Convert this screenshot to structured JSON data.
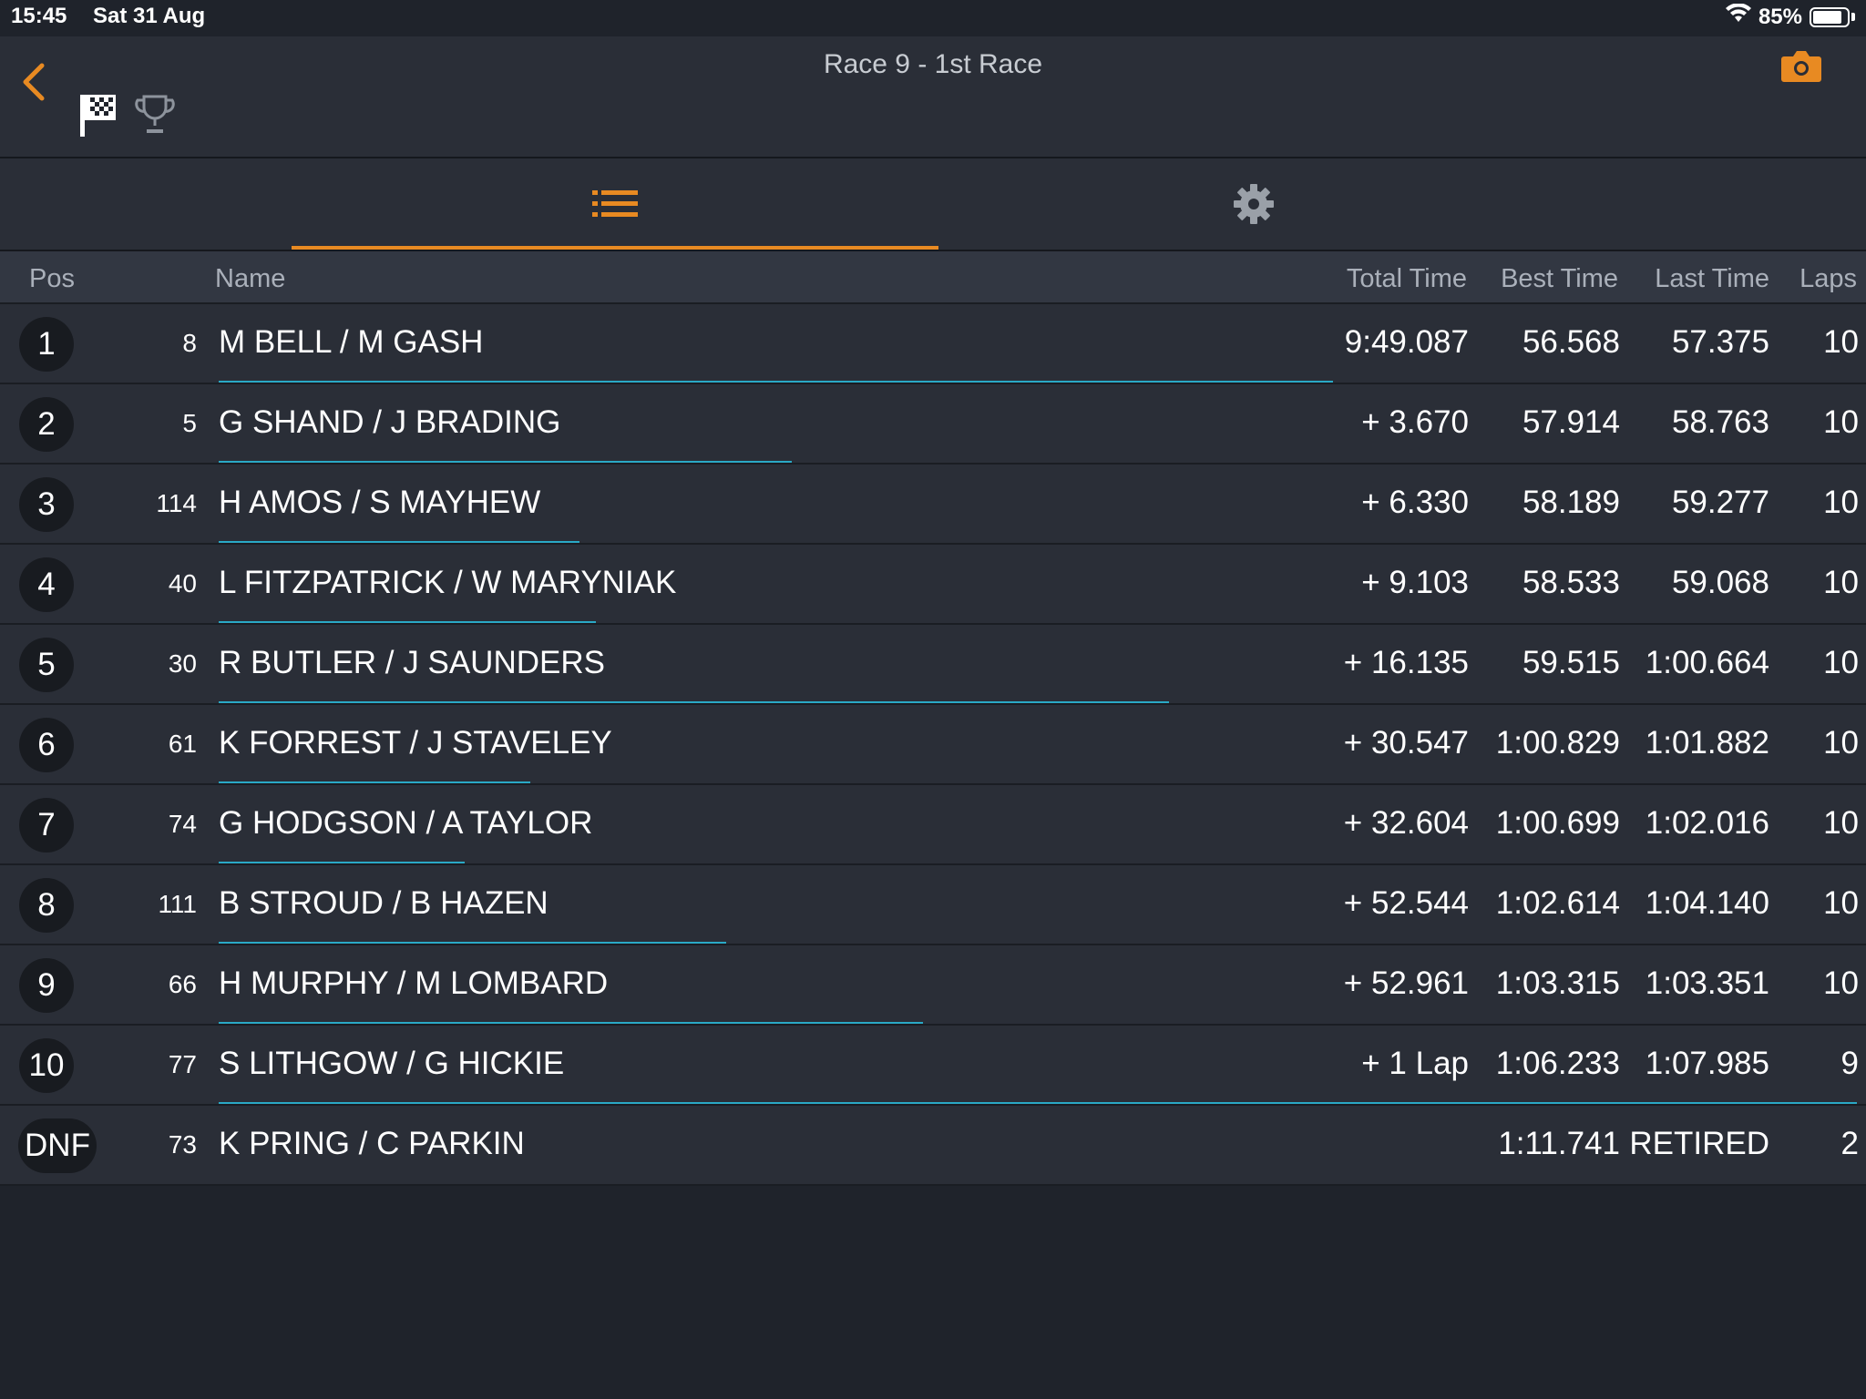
{
  "status": {
    "time": "15:45",
    "date": "Sat 31 Aug",
    "battery": "85%",
    "battery_level": 0.85
  },
  "header": {
    "title": "Race 9 - 1st Race"
  },
  "colors": {
    "accent": "#e88a22",
    "progress": "#2aa9c6",
    "background": "#1f232b",
    "row": "#2a2e37"
  },
  "icons": {
    "back": "chevron-left-icon",
    "flag": "checkered-flag-icon",
    "trophy": "trophy-icon",
    "camera": "camera-icon",
    "list": "list-icon",
    "settings": "gear-icon"
  },
  "tabs": {
    "active": "list"
  },
  "columns": {
    "pos": "Pos",
    "name": "Name",
    "total": "Total Time",
    "best": "Best Time",
    "last": "Last Time",
    "laps": "Laps"
  },
  "results": [
    {
      "pos": "1",
      "num": "8",
      "name": "M BELL / M GASH",
      "total": "9:49.087",
      "best": "56.568",
      "last": "57.375",
      "laps": "10",
      "progress": 0.68
    },
    {
      "pos": "2",
      "num": "5",
      "name": "G SHAND / J BRADING",
      "total": "+ 3.670",
      "best": "57.914",
      "last": "58.763",
      "laps": "10",
      "progress": 0.35
    },
    {
      "pos": "3",
      "num": "114",
      "name": "H AMOS / S MAYHEW",
      "total": "+ 6.330",
      "best": "58.189",
      "last": "59.277",
      "laps": "10",
      "progress": 0.22
    },
    {
      "pos": "4",
      "num": "40",
      "name": "L FITZPATRICK / W MARYNIAK",
      "total": "+ 9.103",
      "best": "58.533",
      "last": "59.068",
      "laps": "10",
      "progress": 0.23
    },
    {
      "pos": "5",
      "num": "30",
      "name": "R BUTLER / J SAUNDERS",
      "total": "+ 16.135",
      "best": "59.515",
      "last": "1:00.664",
      "laps": "10",
      "progress": 0.58
    },
    {
      "pos": "6",
      "num": "61",
      "name": "K FORREST / J STAVELEY",
      "total": "+ 30.547",
      "best": "1:00.829",
      "last": "1:01.882",
      "laps": "10",
      "progress": 0.19
    },
    {
      "pos": "7",
      "num": "74",
      "name": "G HODGSON / A TAYLOR",
      "total": "+ 32.604",
      "best": "1:00.699",
      "last": "1:02.016",
      "laps": "10",
      "progress": 0.15
    },
    {
      "pos": "8",
      "num": "111",
      "name": "B STROUD / B HAZEN",
      "total": "+ 52.544",
      "best": "1:02.614",
      "last": "1:04.140",
      "laps": "10",
      "progress": 0.31
    },
    {
      "pos": "9",
      "num": "66",
      "name": "H MURPHY / M LOMBARD",
      "total": "+ 52.961",
      "best": "1:03.315",
      "last": "1:03.351",
      "laps": "10",
      "progress": 0.43
    },
    {
      "pos": "10",
      "num": "77",
      "name": "S LITHGOW / G HICKIE",
      "total": "+ 1 Lap",
      "best": "1:06.233",
      "last": "1:07.985",
      "laps": "9",
      "progress": 1.0
    },
    {
      "pos": "DNF",
      "num": "73",
      "name": "K PRING / C PARKIN",
      "total": "",
      "best": "1:11.741",
      "last": "RETIRED",
      "laps": "2",
      "progress": 0
    }
  ]
}
